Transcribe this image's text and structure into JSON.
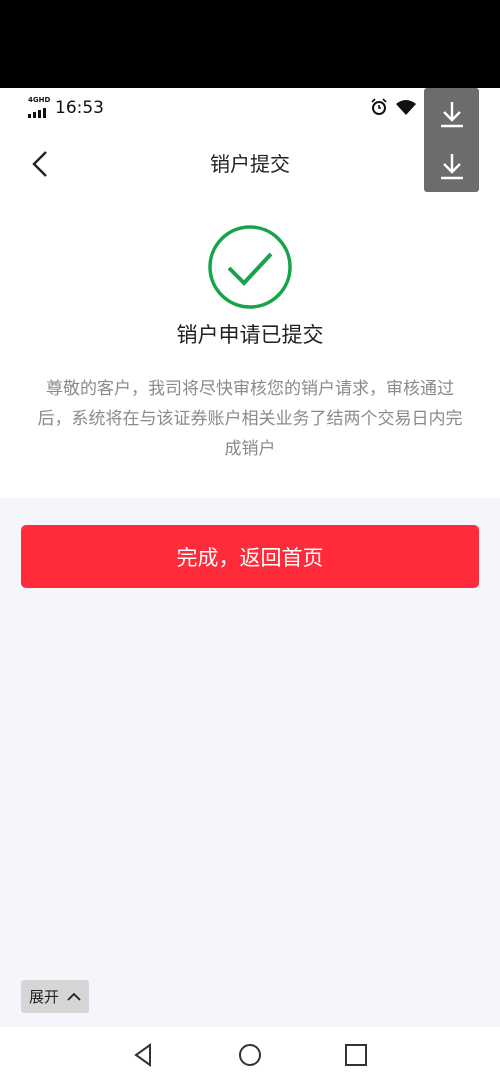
{
  "status_bar": {
    "network": "4GHD",
    "time": "16:53"
  },
  "header": {
    "title": "销户提交"
  },
  "result": {
    "title": "销户申请已提交",
    "description": "尊敬的客户，我司将尽快审核您的销户请求，审核通过后，系统将在与该证券账户相关业务了结两个交易日内完成销户"
  },
  "actions": {
    "done_label": "完成，返回首页",
    "expand_label": "展开"
  },
  "colors": {
    "accent": "#ff2a3a",
    "success": "#18a34a"
  },
  "icons": [
    "back-icon",
    "download-icon",
    "check-circle-icon",
    "chevron-up-icon",
    "alarm-icon",
    "wifi-icon",
    "nav-back-icon",
    "nav-home-icon",
    "nav-recents-icon"
  ]
}
